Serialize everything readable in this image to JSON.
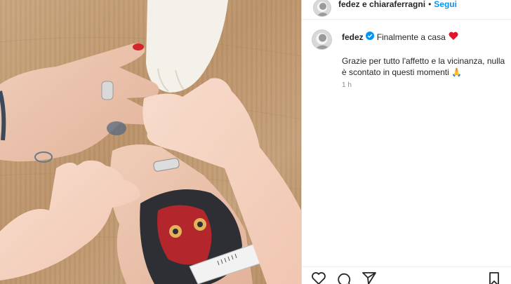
{
  "post": {
    "header": {
      "users": "fedez e chiaraferragni",
      "dot": "•",
      "follow_label": "Segui"
    },
    "caption": {
      "username": "fedez",
      "title": "Finalmente a casa",
      "body": "Grazie per tutto l'affetto e la vicinanza, nulla è scontato in questi momenti 🙏",
      "time": "1 h"
    },
    "icons": {
      "verified": "verified-badge-icon",
      "heart_emoji": "red-heart-icon",
      "like": "heart-icon",
      "comment": "comment-icon",
      "share": "send-icon",
      "save": "bookmark-icon"
    },
    "colors": {
      "accent": "#0095f6",
      "text": "#262626",
      "muted": "#8e8e8e",
      "heart": "#ed4956"
    }
  }
}
